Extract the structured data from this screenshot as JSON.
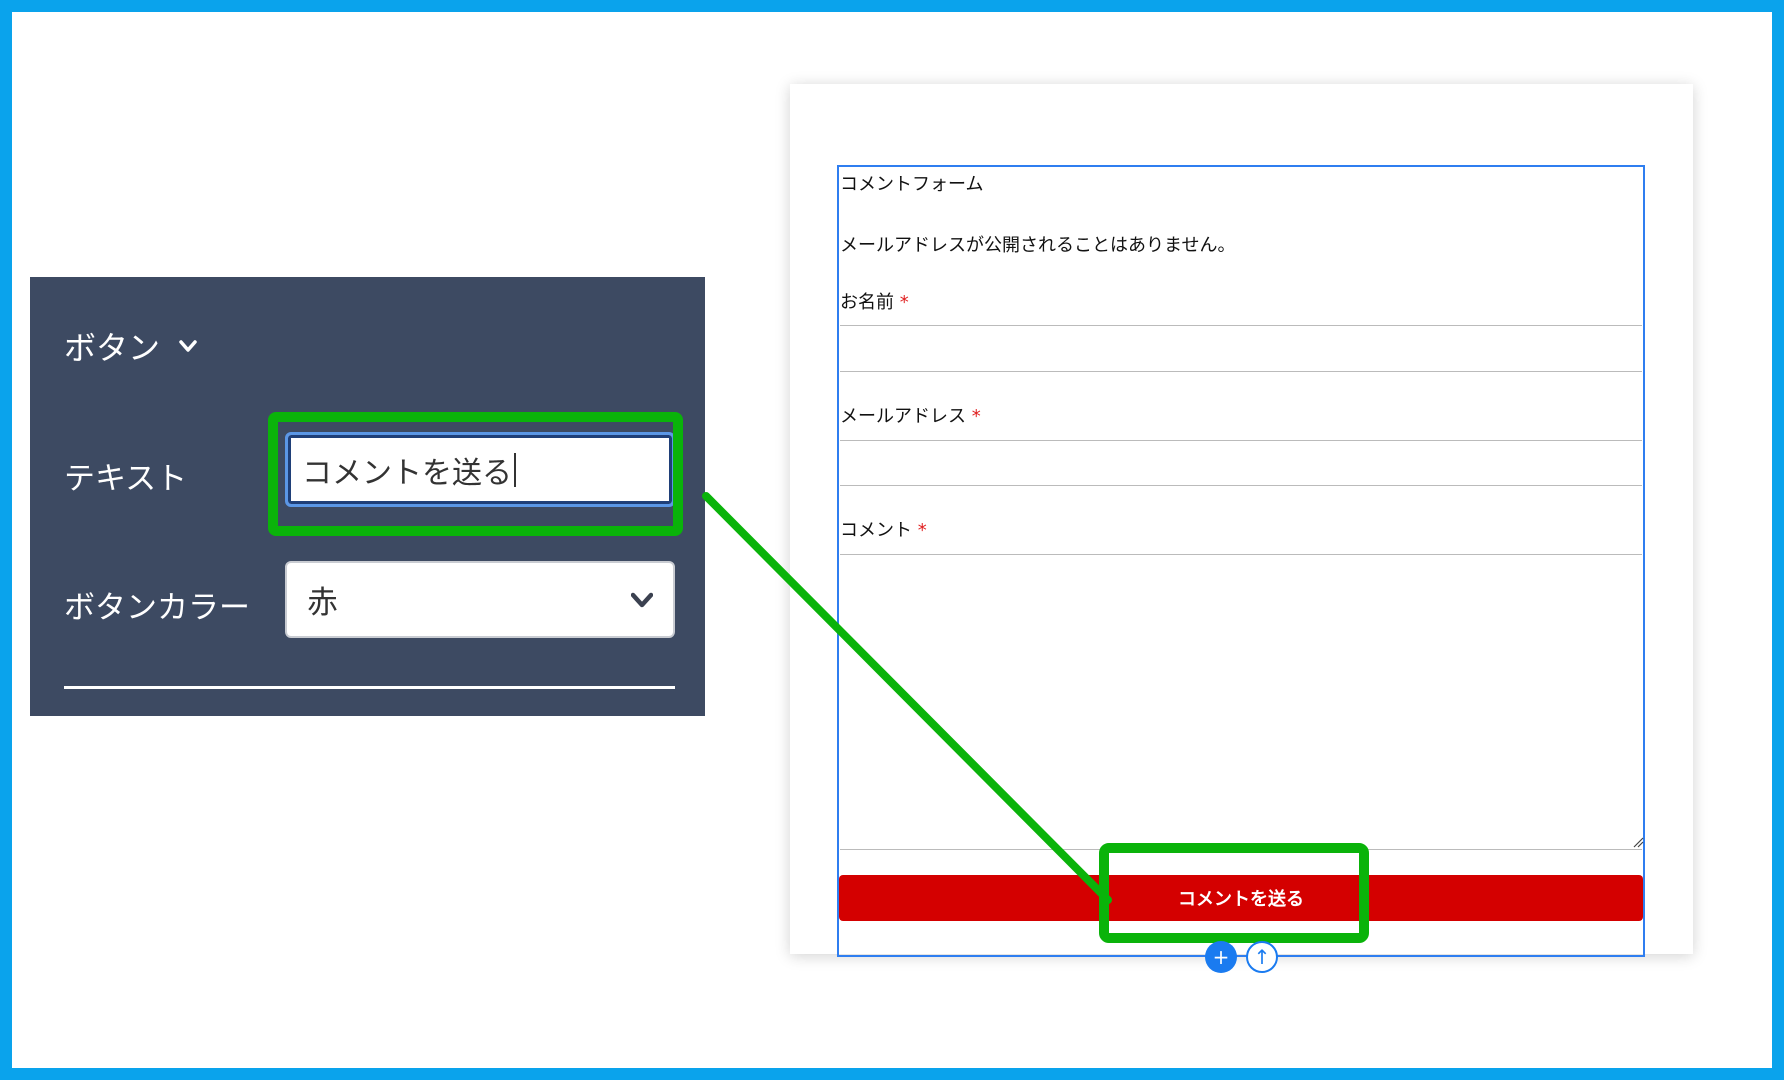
{
  "panel": {
    "title": "ボタン",
    "text_label": "テキスト",
    "text_value": "コメントを送る",
    "color_label": "ボタンカラー",
    "color_value": "赤"
  },
  "form": {
    "heading": "コメントフォーム",
    "notice": "メールアドレスが公開されることはありません。",
    "name_label": "お名前",
    "email_label": "メールアドレス",
    "comment_label": "コメント",
    "required_mark": "*",
    "submit_label": "コメントを送る"
  },
  "toolbar": {
    "add_symbol": "+",
    "up_symbol": "↑"
  },
  "colors": {
    "frame": "#0aa3ec",
    "panel_bg": "#3d4a62",
    "highlight": "#0ab30a",
    "submit_bg": "#d40000",
    "selection": "#2f7ef0",
    "required": "#e02020"
  },
  "icons": [
    "chevron-down-icon",
    "caret",
    "plus-icon",
    "arrow-up-icon",
    "resize-handle-icon"
  ]
}
